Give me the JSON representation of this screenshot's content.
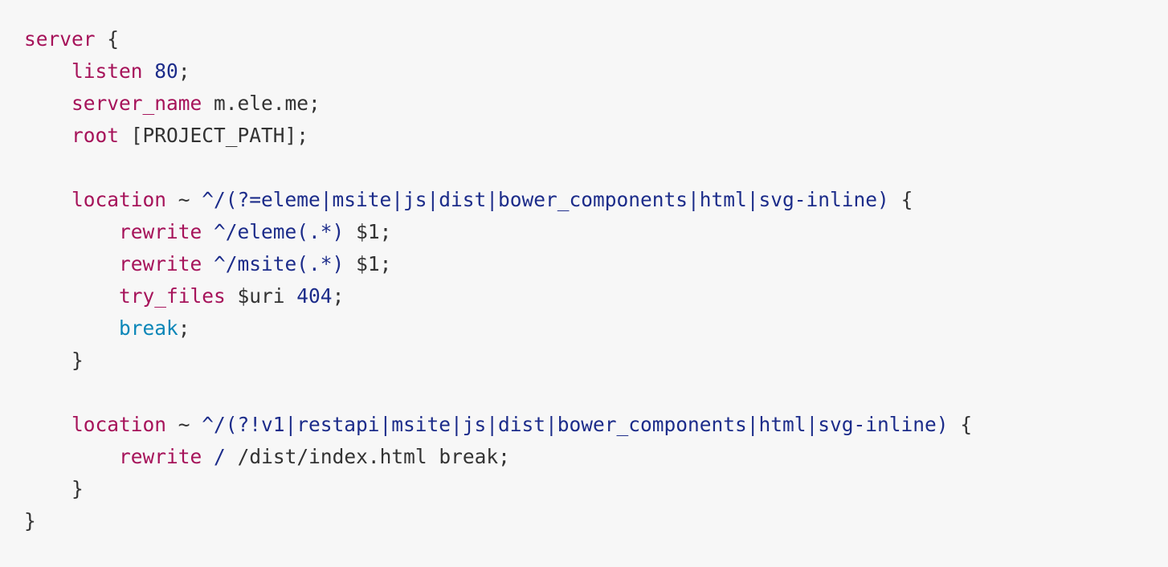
{
  "code": {
    "lines": [
      [
        {
          "t": "server",
          "k": "key"
        },
        {
          "t": " {",
          "k": "txt"
        }
      ],
      [
        {
          "t": "    ",
          "k": "txt"
        },
        {
          "t": "listen",
          "k": "key"
        },
        {
          "t": " ",
          "k": "txt"
        },
        {
          "t": "80",
          "k": "num"
        },
        {
          "t": ";",
          "k": "txt"
        }
      ],
      [
        {
          "t": "    ",
          "k": "txt"
        },
        {
          "t": "server_name",
          "k": "key"
        },
        {
          "t": " m.ele.me;",
          "k": "txt"
        }
      ],
      [
        {
          "t": "    ",
          "k": "txt"
        },
        {
          "t": "root",
          "k": "key"
        },
        {
          "t": " [PROJECT_PATH];",
          "k": "txt"
        }
      ],
      [],
      [
        {
          "t": "    ",
          "k": "txt"
        },
        {
          "t": "location",
          "k": "key"
        },
        {
          "t": " ~ ",
          "k": "txt"
        },
        {
          "t": "^/(?=eleme|msite|js|dist|bower_components|html|svg-inline)",
          "k": "re"
        },
        {
          "t": " {",
          "k": "txt"
        }
      ],
      [
        {
          "t": "        ",
          "k": "txt"
        },
        {
          "t": "rewrite",
          "k": "key"
        },
        {
          "t": " ",
          "k": "txt"
        },
        {
          "t": "^/eleme(.*)",
          "k": "re"
        },
        {
          "t": " $1;",
          "k": "txt"
        }
      ],
      [
        {
          "t": "        ",
          "k": "txt"
        },
        {
          "t": "rewrite",
          "k": "key"
        },
        {
          "t": " ",
          "k": "txt"
        },
        {
          "t": "^/msite(.*)",
          "k": "re"
        },
        {
          "t": " $1;",
          "k": "txt"
        }
      ],
      [
        {
          "t": "        ",
          "k": "txt"
        },
        {
          "t": "try_files",
          "k": "key"
        },
        {
          "t": " $uri ",
          "k": "txt"
        },
        {
          "t": "404",
          "k": "num"
        },
        {
          "t": ";",
          "k": "txt"
        }
      ],
      [
        {
          "t": "        ",
          "k": "txt"
        },
        {
          "t": "break",
          "k": "kw"
        },
        {
          "t": ";",
          "k": "txt"
        }
      ],
      [
        {
          "t": "    }",
          "k": "txt"
        }
      ],
      [],
      [
        {
          "t": "    ",
          "k": "txt"
        },
        {
          "t": "location",
          "k": "key"
        },
        {
          "t": " ~ ",
          "k": "txt"
        },
        {
          "t": "^/(?!v1|restapi|msite|js|dist|bower_components|html|svg-inline)",
          "k": "re"
        },
        {
          "t": " {",
          "k": "txt"
        }
      ],
      [
        {
          "t": "        ",
          "k": "txt"
        },
        {
          "t": "rewrite",
          "k": "key"
        },
        {
          "t": " ",
          "k": "txt"
        },
        {
          "t": "/",
          "k": "re"
        },
        {
          "t": " /dist/index.html break;",
          "k": "txt"
        }
      ],
      [
        {
          "t": "    }",
          "k": "txt"
        }
      ],
      [
        {
          "t": "}",
          "k": "txt"
        }
      ]
    ]
  },
  "colors": {
    "background": "#f7f7f7",
    "directive": "#a6135a",
    "number": "#1c2c8a",
    "regex": "#1c2c8a",
    "keyword": "#0a86b8",
    "text": "#333333"
  }
}
